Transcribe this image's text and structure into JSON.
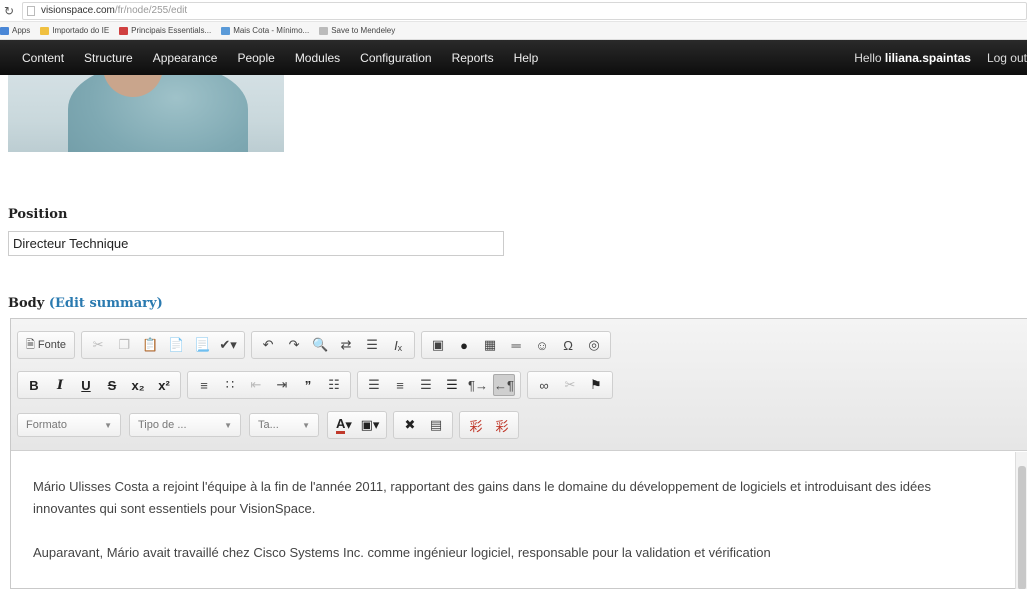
{
  "browser": {
    "url_domain": "visionspace.com",
    "url_path": "/fr/node/255/edit",
    "bookmarks": [
      {
        "label": "Apps",
        "color": "#4a87d6"
      },
      {
        "label": "Importado do IE",
        "color": "#f0c040"
      },
      {
        "label": "Principais Essentials...",
        "color": "#d04040"
      },
      {
        "label": "Mais Cota - Mínimo...",
        "color": "#5a9ad8"
      },
      {
        "label": "Save to Mendeley",
        "color": "#bbbbbb"
      }
    ]
  },
  "admin": {
    "menu": [
      "Content",
      "Structure",
      "Appearance",
      "People",
      "Modules",
      "Configuration",
      "Reports",
      "Help"
    ],
    "hello_prefix": "Hello ",
    "username": "liliana.spaintas",
    "logout": "Log out"
  },
  "form": {
    "position_label": "Position",
    "position_value": "Directeur Technique",
    "body_label": "Body",
    "body_edit_summary": "(Edit summary)"
  },
  "editor": {
    "source_label": "Fonte",
    "format_label": "Formato",
    "font_label": "Tipo de ...",
    "size_label": "Ta...",
    "paragraphs": [
      "Mário Ulisses Costa a rejoint l'équipe à la fin de l'année 2011, rapportant des gains dans le domaine du développement de logiciels et introduisant des idées innovantes qui sont essentiels pour VisionSpace.",
      "Auparavant, Mário avait travaillé chez Cisco Systems Inc. comme ingénieur logiciel, responsable pour la validation et vérification"
    ]
  }
}
